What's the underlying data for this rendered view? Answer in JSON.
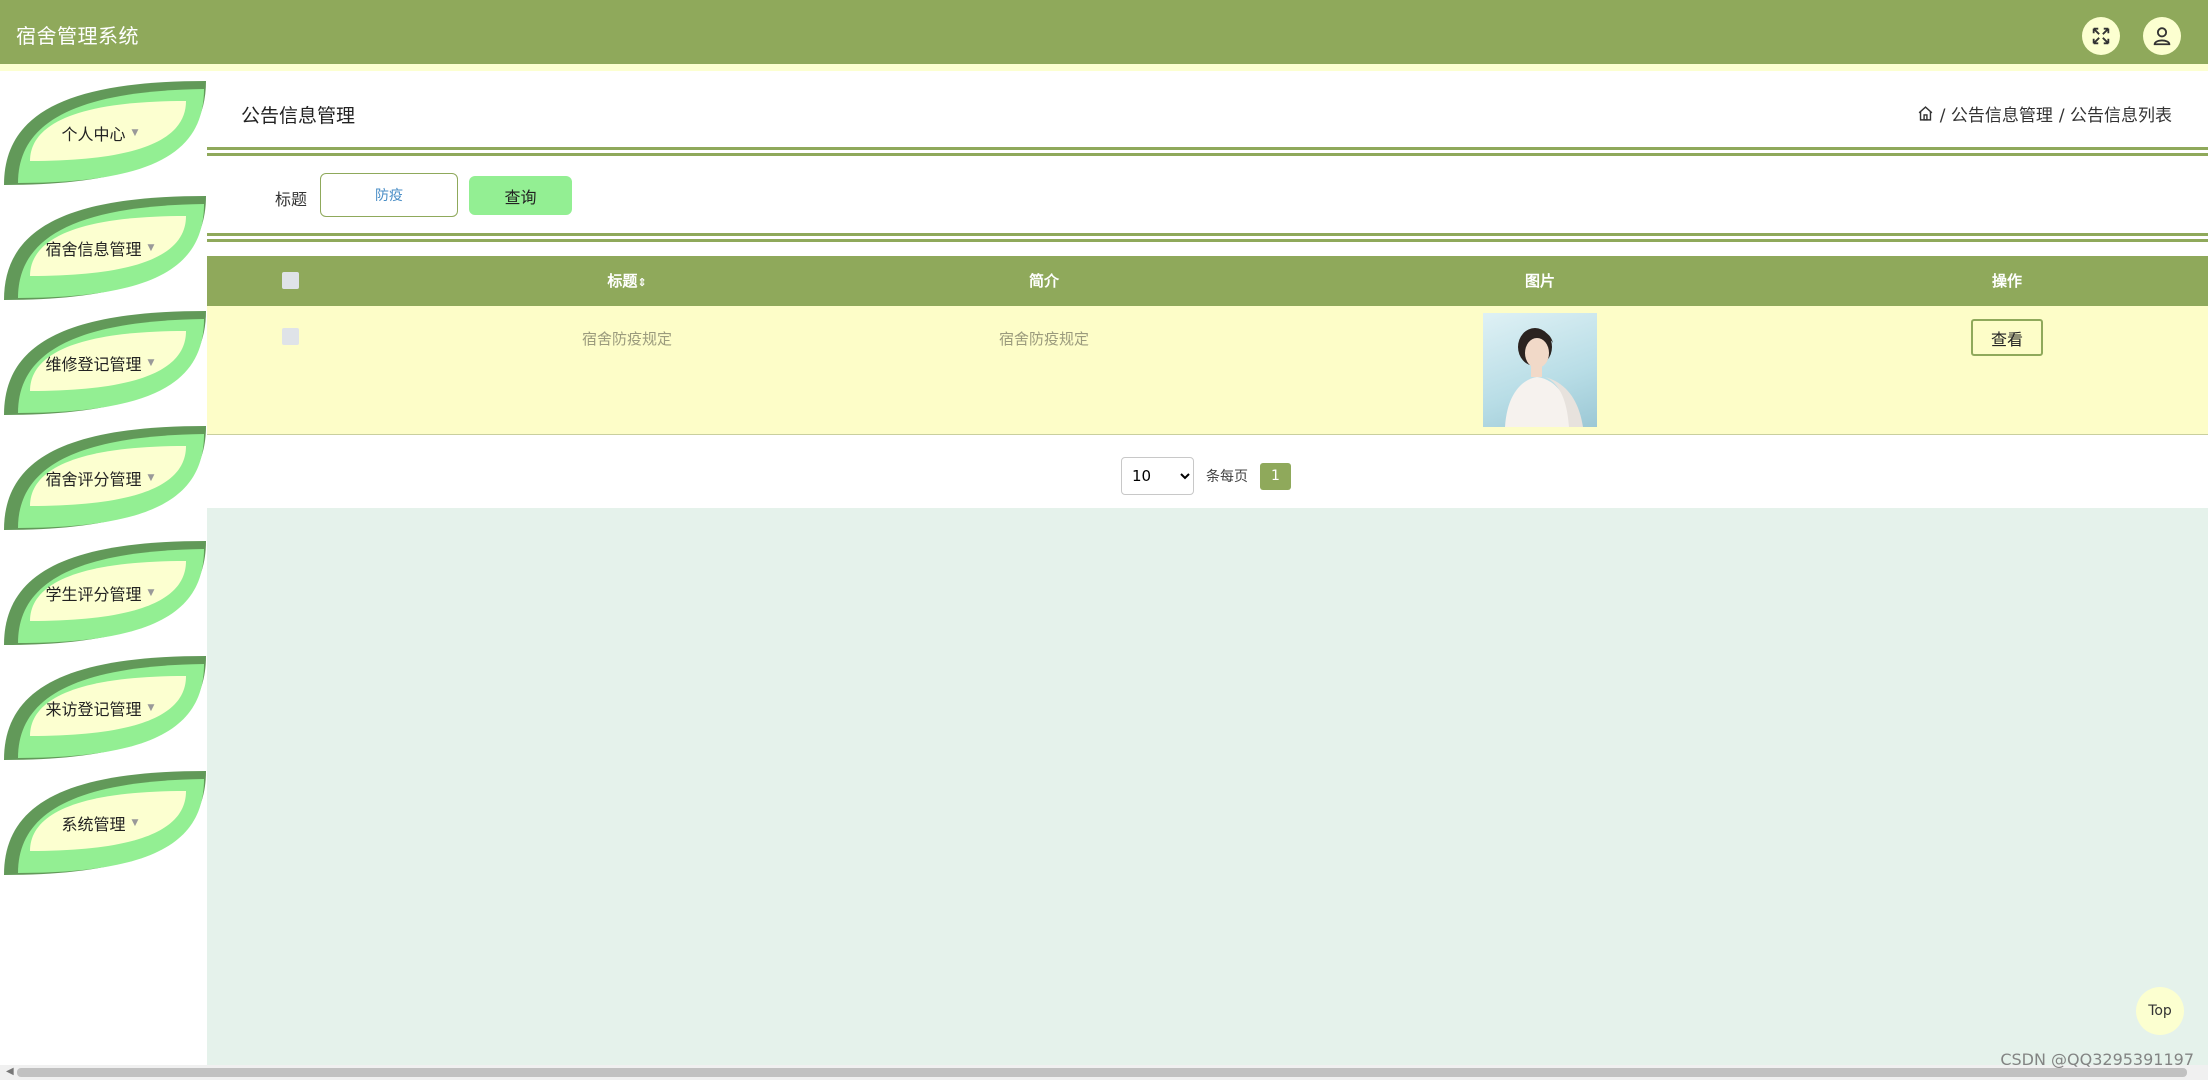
{
  "app": {
    "title": "宿舍管理系统"
  },
  "header": {
    "fullscreen_icon": "fullscreen-icon",
    "user_icon": "user-icon"
  },
  "sidebar": {
    "items": [
      {
        "label": "个人中心"
      },
      {
        "label": "宿舍信息管理"
      },
      {
        "label": "维修登记管理"
      },
      {
        "label": "宿舍评分管理"
      },
      {
        "label": "学生评分管理"
      },
      {
        "label": "来访登记管理"
      },
      {
        "label": "系统管理"
      }
    ]
  },
  "page": {
    "title": "公告信息管理",
    "breadcrumb": [
      "/ 公告信息管理",
      "/ 公告信息列表"
    ]
  },
  "search": {
    "label": "标题",
    "value": "防疫",
    "button": "查询"
  },
  "table": {
    "headers": {
      "title": "标题",
      "intro": "简介",
      "image": "图片",
      "action": "操作"
    },
    "rows": [
      {
        "title": "宿舍防疫规定",
        "intro": "宿舍防疫规定",
        "action": "查看"
      }
    ]
  },
  "pagination": {
    "page_size": "10",
    "page_size_options": [
      "10"
    ],
    "per_page_label": "条每页",
    "current_page": "1"
  },
  "footer": {
    "top_button": "Top",
    "watermark": "CSDN @QQ3295391197"
  },
  "colors": {
    "primary": "#8fa95b",
    "accent_light": "#fcffd0",
    "row_bg": "#fdfdc8",
    "button_green": "#93ef93",
    "content_bg": "#e5f2eb"
  }
}
